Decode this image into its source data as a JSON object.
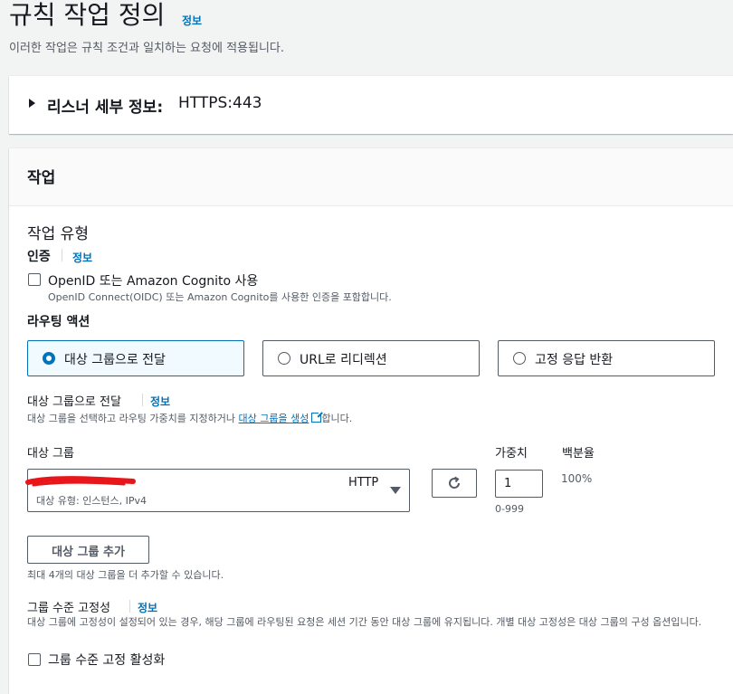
{
  "header": {
    "title": "규칙 작업 정의",
    "info_link": "정보",
    "description": "이러한 작업은 규칙 조건과 일치하는 요청에 적용됩니다."
  },
  "listener": {
    "label": "리스너 세부 정보:",
    "value": "HTTPS:443"
  },
  "actions": {
    "title": "작업",
    "type_heading": "작업 유형",
    "auth": {
      "label": "인증",
      "info_link": "정보",
      "checkbox_label": "OpenID 또는 Amazon Cognito 사용",
      "checkbox_desc": "OpenID Connect(OIDC) 또는 Amazon Cognito를 사용한 인증을 포함합니다.",
      "checked": false
    },
    "routing": {
      "label": "라우팅 액션",
      "options": [
        "대상 그룹으로 전달",
        "URL로 리디렉션",
        "고정 응답 반환"
      ],
      "selected_index": 0
    },
    "forward": {
      "label": "대상 그룹으로 전달",
      "info_link": "정보",
      "desc_before": "대상 그룹을 선택하고 라우팅 가중치를 지정하거나",
      "desc_link": "대상 그룹을 생성",
      "desc_after": "합니다."
    },
    "target_group": {
      "col_label": "대상 그룹",
      "weight_label": "가중치",
      "percent_label": "백분율",
      "protocol": "HTTP",
      "type_text": "대상 유형: 인스턴스, IPv4",
      "weight_value": "1",
      "weight_hint": "0-999",
      "percent_value": "100%"
    },
    "add_button": "대상 그룹 추가",
    "add_hint": "최대 4개의 대상 그룹을 더 추가할 수 있습니다.",
    "stickiness": {
      "label": "그룹 수준 고정성",
      "info_link": "정보",
      "desc": "대상 그룹에 고정성이 설정되어 있는 경우, 해당 그룹에 라우팅된 요청은 세션 기간 동안 대상 그룹에 유지됩니다. 개별 대상 고정성은 대상 그룹의 구성 옵션입니다.",
      "checkbox_label": "그룹 수준 고정 활성화",
      "checked": false
    }
  },
  "colors": {
    "accent": "#0073bb",
    "redaction": "#e8161b"
  }
}
